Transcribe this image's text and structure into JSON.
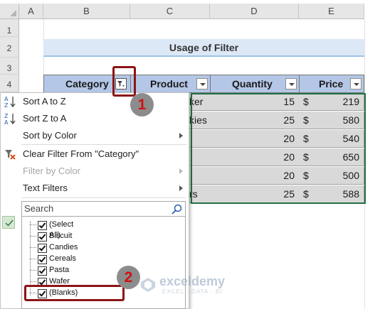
{
  "sheet": {
    "columns": [
      "A",
      "B",
      "C",
      "D",
      "E"
    ],
    "rows": [
      "1",
      "2",
      "3",
      "4"
    ],
    "title": "Usage of Filter"
  },
  "table": {
    "headers": [
      "Category",
      "Product",
      "Quantity",
      "Price"
    ],
    "rows": [
      {
        "product": "ker",
        "quantity": "15",
        "currency": "$",
        "price": "219"
      },
      {
        "product": "kies",
        "quantity": "25",
        "currency": "$",
        "price": "580"
      },
      {
        "product": "",
        "quantity": "20",
        "currency": "$",
        "price": "540"
      },
      {
        "product": "",
        "quantity": "20",
        "currency": "$",
        "price": "650"
      },
      {
        "product": "",
        "quantity": "20",
        "currency": "$",
        "price": "500"
      },
      {
        "product": "rs",
        "quantity": "25",
        "currency": "$",
        "price": "588"
      }
    ]
  },
  "filter_menu": {
    "sort_az": "Sort A to Z",
    "sort_za": "Sort Z to A",
    "sort_color": "Sort by Color",
    "clear_filter": "Clear Filter From \"Category\"",
    "filter_color": "Filter by Color",
    "text_filters": "Text Filters",
    "search_placeholder": "Search",
    "items": [
      {
        "label": "(Select All)",
        "checked": true
      },
      {
        "label": "Biscuit",
        "checked": true
      },
      {
        "label": "Candies",
        "checked": true
      },
      {
        "label": "Cereals",
        "checked": true
      },
      {
        "label": "Pasta",
        "checked": true
      },
      {
        "label": "Wafer",
        "checked": true
      },
      {
        "label": "(Blanks)",
        "checked": true
      }
    ]
  },
  "annotations": {
    "step1": "1",
    "step2": "2"
  },
  "watermark": {
    "name": "exceldemy",
    "tagline": "EXCEL · DATA · BI"
  },
  "colors": {
    "header_fill": "#b4c7e7",
    "title_fill": "#dde8f6",
    "selection": "#217346",
    "callout": "#8b1515"
  }
}
